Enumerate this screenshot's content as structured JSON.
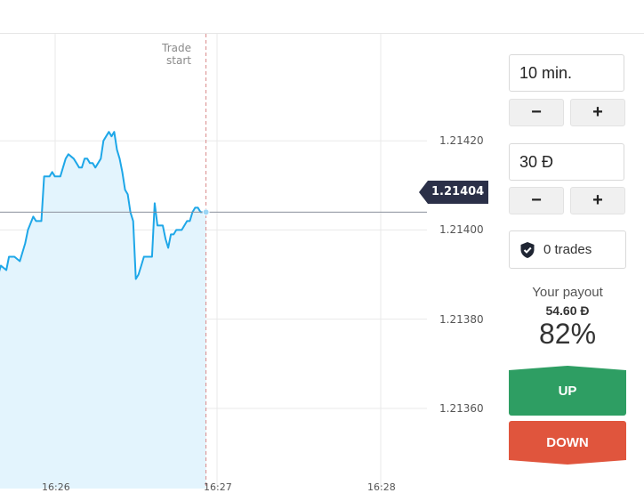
{
  "chart_data": {
    "type": "area",
    "y_ticks": [
      "1.21420",
      "1.21400",
      "1.21380",
      "1.21360"
    ],
    "y_tick_values": [
      1.2142,
      1.214,
      1.2138,
      1.2136
    ],
    "x_ticks": [
      "16:26",
      "16:27",
      "16:28"
    ],
    "ylim": [
      1.21342,
      1.21444
    ],
    "xlim_seconds": [
      0,
      165
    ],
    "x_seconds": [
      0,
      1,
      3,
      4,
      6,
      8,
      10,
      11,
      13,
      14,
      16,
      17,
      18,
      19,
      20,
      21,
      22,
      23,
      24,
      25,
      26,
      28,
      29,
      30,
      31,
      32,
      33,
      34,
      35,
      36,
      38,
      39,
      40,
      41,
      42,
      43,
      44,
      45,
      46,
      47,
      48,
      49,
      50,
      51,
      52,
      53,
      54,
      55,
      56,
      57,
      58,
      59,
      60,
      61,
      62,
      63,
      64,
      65,
      66,
      67,
      68,
      69,
      70,
      71,
      72,
      73,
      74,
      75,
      76,
      77
    ],
    "values": [
      1.2139,
      1.21392,
      1.21391,
      1.21394,
      1.21394,
      1.21393,
      1.21397,
      1.214,
      1.21403,
      1.21402,
      1.21402,
      1.21412,
      1.21412,
      1.21412,
      1.21413,
      1.21412,
      1.21412,
      1.21412,
      1.21414,
      1.21416,
      1.21417,
      1.21416,
      1.21415,
      1.21414,
      1.21414,
      1.21416,
      1.21416,
      1.21415,
      1.21415,
      1.21414,
      1.21416,
      1.2142,
      1.21421,
      1.21422,
      1.21421,
      1.21422,
      1.21418,
      1.21416,
      1.21413,
      1.21409,
      1.21408,
      1.21404,
      1.21402,
      1.21389,
      1.2139,
      1.21392,
      1.21394,
      1.21394,
      1.21394,
      1.21394,
      1.21406,
      1.21401,
      1.21401,
      1.21401,
      1.21398,
      1.21396,
      1.21399,
      1.21399,
      1.214,
      1.214,
      1.214,
      1.21401,
      1.21402,
      1.21402,
      1.21404,
      1.21405,
      1.21405,
      1.21404,
      1.21404,
      1.21404
    ],
    "current_price": "1.21404",
    "trade_start_label": [
      "Trade",
      "start"
    ],
    "colors": {
      "line": "#1ea7e8",
      "fill": "#e3f4fd",
      "grid": "#e9e9e9",
      "price_tag": "#2b3048"
    }
  },
  "panel": {
    "duration_value": "10 min.",
    "amount_value": "30 Đ",
    "minus_label": "−",
    "plus_label": "+",
    "trades_label": "0 trades",
    "payout_title": "Your payout",
    "payout_amount": "54.60 Đ",
    "payout_percent": "82%",
    "up_label": "UP",
    "down_label": "DOWN",
    "colors": {
      "up": "#2e9e63",
      "down": "#e0553d"
    }
  }
}
